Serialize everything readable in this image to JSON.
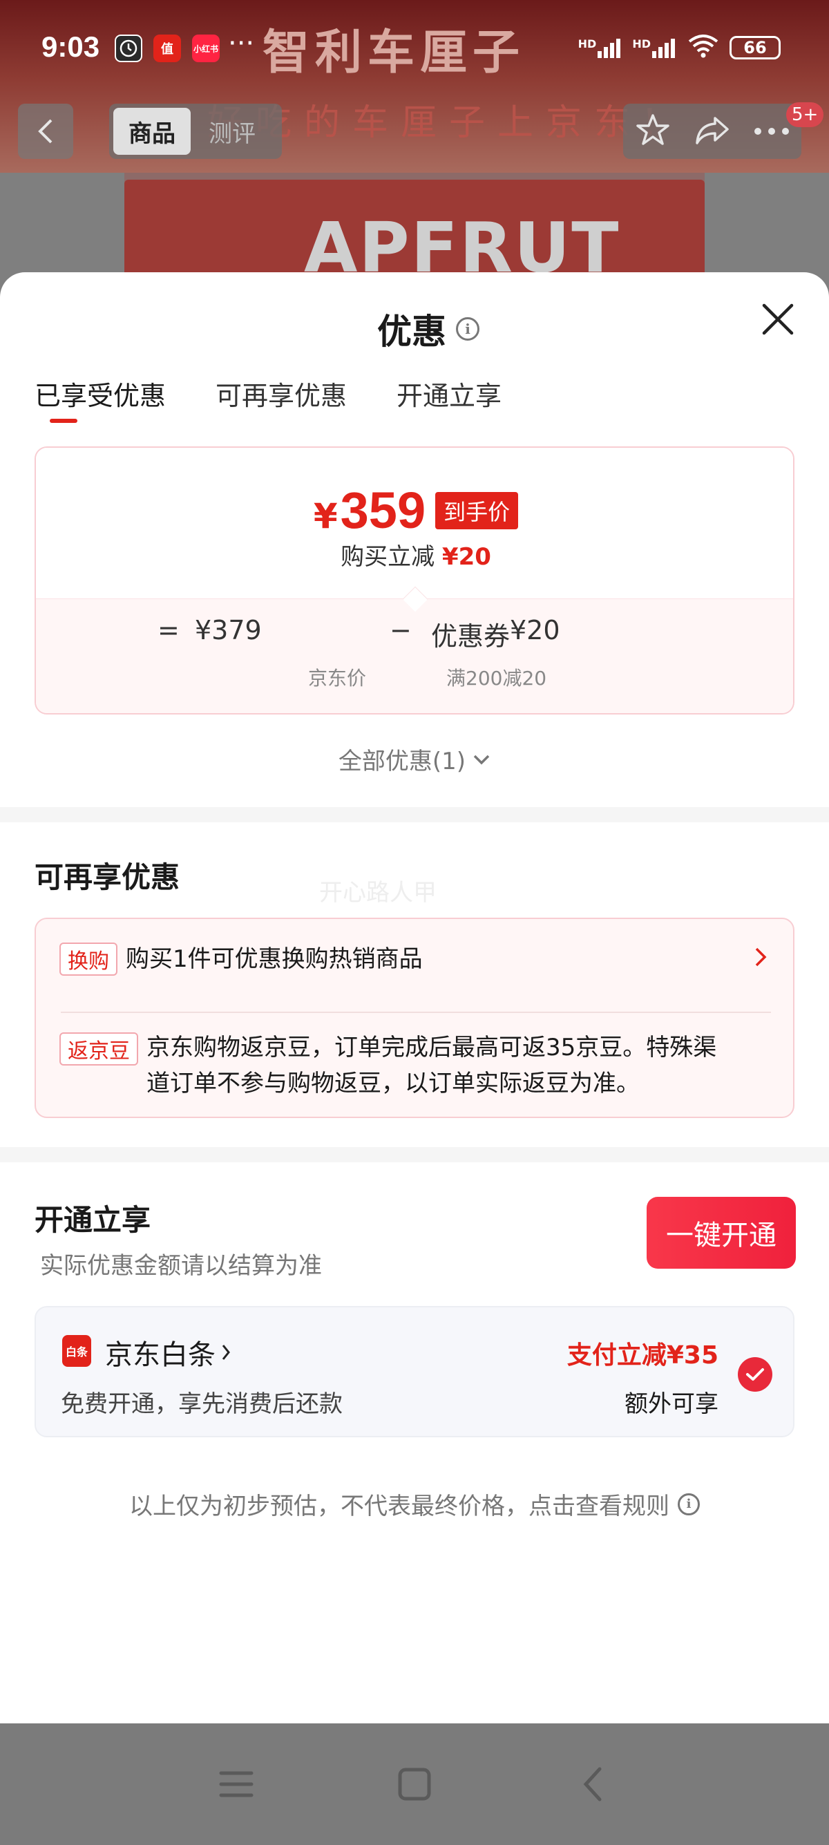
{
  "status_bar": {
    "time": "9:03",
    "dots": "···",
    "signal1": "HD",
    "signal2": "HD",
    "battery": "66",
    "app_icons": [
      {
        "name": "clock-app-icon",
        "color": "#2a2a2a"
      },
      {
        "name": "smzdm-app-icon",
        "label": "值",
        "color": "#e2231a"
      },
      {
        "name": "xiaohongshu-app-icon",
        "label": "小红书",
        "color": "#ff2442"
      }
    ]
  },
  "background_page": {
    "banner_title": "智利车厘子",
    "banner_subtitle": "好吃的车厘子上京东!",
    "product_brand": "APFRUT",
    "nav_tabs": [
      "商品",
      "测评"
    ],
    "badge": "5+"
  },
  "sheet": {
    "title": "优惠",
    "tabs": [
      "已享受优惠",
      "可再享优惠",
      "开通立享"
    ],
    "active_tab": 0,
    "price_card": {
      "yen": "¥",
      "final_price": "359",
      "price_tag": "到手价",
      "sub_label": "购买立减",
      "sub_amount": "¥20",
      "equals": "=",
      "original_price": "¥379",
      "minus": "−",
      "coupon_label": "优惠券",
      "coupon_amount": "¥20",
      "original_caption": "京东价",
      "coupon_caption": "满200减20"
    },
    "all_discounts": "全部优惠(1)",
    "more_section": {
      "title": "可再享优惠",
      "watermark": "开心路人甲",
      "items": [
        {
          "tag": "换购",
          "text": "购买1件可优惠换购热销商品"
        },
        {
          "tag": "返京豆",
          "text_line1": "京东购物返京豆，订单完成后最高可返35京豆。特殊渠",
          "text_line2": "道订单不参与购物返豆，以订单实际返豆为准。"
        }
      ]
    },
    "open_section": {
      "title": "开通立享",
      "note": "实际优惠金额请以结算为准",
      "button": "一键开通",
      "baitiao": {
        "logo": "白条",
        "name": "京东白条",
        "desc": "免费开通，享先消费后还款",
        "pay_discount": "支付立减¥35",
        "extra": "额外可享",
        "checked": true
      }
    },
    "disclaimer": "以上仅为初步预估，不代表最终价格，点击查看规则"
  },
  "colors": {
    "accent": "#e2231a",
    "button": "#f0213c"
  }
}
